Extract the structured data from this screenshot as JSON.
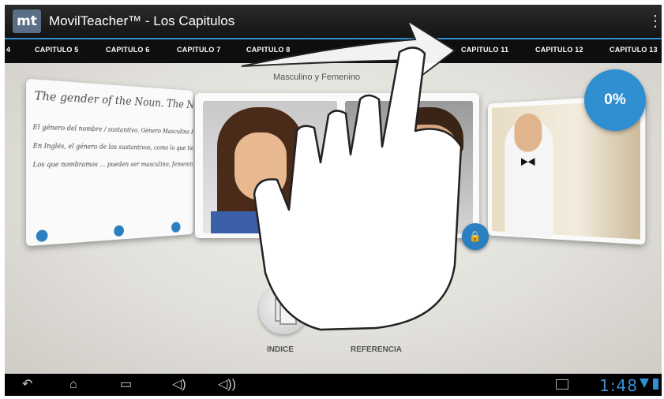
{
  "app": {
    "logo_text": "mt",
    "title": "MovilTeacher™ - Los Capitulos"
  },
  "tabs": [
    {
      "label": "4"
    },
    {
      "label": "CAPITULO 5"
    },
    {
      "label": "CAPITULO 6"
    },
    {
      "label": "CAPITULO 7"
    },
    {
      "label": "CAPITULO 8"
    },
    {
      "label": "CAPITULO 11"
    },
    {
      "label": "CAPITULO 12"
    },
    {
      "label": "CAPITULO 13"
    }
  ],
  "lesson": {
    "title": "Masculino y Femenino"
  },
  "left_card": {
    "heading": "The gender of the Noun. The Noun",
    "lines": [
      "El género del nombre / sustantivo. Género Masculino Femenino o Neutro",
      "En Inglés, el género de los sustantivos, como lo que tienen ...",
      "Los que nombramos ... pueden ser masculino, femenino o neutro"
    ]
  },
  "progress": {
    "value": "0%"
  },
  "actions": {
    "index_label": "INDICE",
    "reference_label": "REFERENCIA"
  },
  "status": {
    "time": "1:48"
  },
  "colors": {
    "accent": "#2f8fd0",
    "action_bar": "#1c1c1c",
    "nav_bar": "#000000"
  }
}
